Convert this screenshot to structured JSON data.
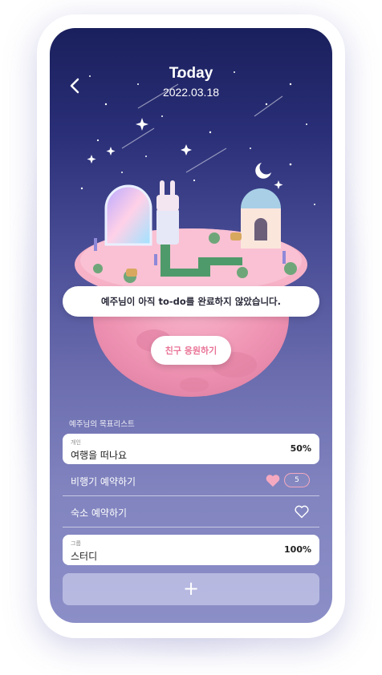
{
  "header": {
    "title": "Today",
    "date": "2022.03.18",
    "back_icon": "chevron-left-icon"
  },
  "notice": {
    "text": "예주님이 아직 to-do를 완료하지 않았습니다."
  },
  "cheer_button": {
    "label": "친구 응원하기"
  },
  "goal_list": {
    "title": "예주님의 목표리스트",
    "groups": [
      {
        "tag": "개인",
        "name": "여행을 떠나요",
        "percent": "50%",
        "tasks": [
          {
            "label": "비행기 예약하기",
            "liked": true,
            "count": "5"
          },
          {
            "label": "숙소 예약하기",
            "liked": false
          }
        ]
      },
      {
        "tag": "그룹",
        "name": "스터디",
        "percent": "100%"
      }
    ]
  },
  "add_button": {
    "label": "+"
  },
  "colors": {
    "accent_pink": "#e97396",
    "heart_pink": "#f5a9c0",
    "bg_top": "#1a1f5c",
    "bg_bottom": "#8b8ec7",
    "island": "#f4a3bf"
  }
}
